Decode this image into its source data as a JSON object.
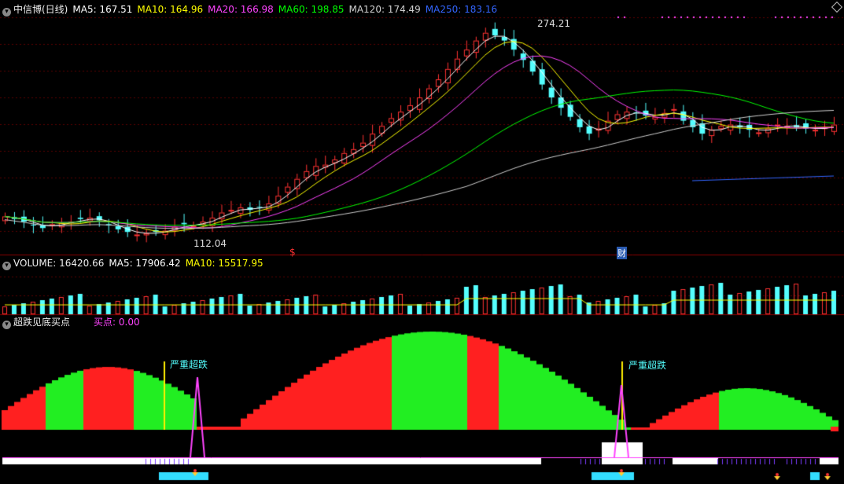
{
  "main_header": {
    "title": "中信博(日线)",
    "ma5": "MA5: 167.51",
    "ma10": "MA10: 164.96",
    "ma20": "MA20: 166.98",
    "ma60": "MA60: 198.85",
    "ma120": "MA120: 174.49",
    "ma250": "MA250: 183.16"
  },
  "volume_header": {
    "title": "VOLUME: 16420.66",
    "ma5": "MA5: 17906.42",
    "ma10": "MA10: 15517.95"
  },
  "indicator_header": {
    "title": "超跌见底买点",
    "buy": "买点: 0.00"
  },
  "price_labels": {
    "high": "274.21",
    "low": "112.04"
  },
  "markers": {
    "s_mark": "$",
    "cai_mark": "财",
    "signal_1": "严重超跌",
    "signal_2": "严重超跌"
  },
  "colors": {
    "ma5": "#ffffff",
    "ma10": "#ffff00",
    "ma20": "#ff44ff",
    "ma60": "#00ff00",
    "ma120": "#d0d0d0",
    "ma250": "#3366ff",
    "up": "#ff3232",
    "down": "#54ffff",
    "grid": "#7a0000"
  },
  "chart_data": {
    "type": "candlestick",
    "close": [
      126,
      124,
      122,
      119,
      117,
      120,
      121,
      122,
      124,
      125,
      123,
      119,
      116,
      114,
      112,
      113,
      114,
      115,
      118,
      120,
      119,
      122,
      125,
      129,
      131,
      133,
      131,
      133,
      136,
      142,
      149,
      155,
      161,
      165,
      166,
      170,
      175,
      178,
      183,
      190,
      196,
      202,
      207,
      212,
      218,
      225,
      232,
      240,
      248,
      255,
      262,
      268,
      266,
      262,
      255,
      247,
      238,
      228,
      218,
      210,
      203,
      195,
      190,
      194,
      200,
      205,
      207,
      206,
      204,
      203,
      206,
      209,
      200,
      195,
      190,
      193,
      196,
      197,
      195,
      193,
      191,
      194,
      197,
      196,
      195,
      194,
      193,
      195,
      197
    ]
  }
}
